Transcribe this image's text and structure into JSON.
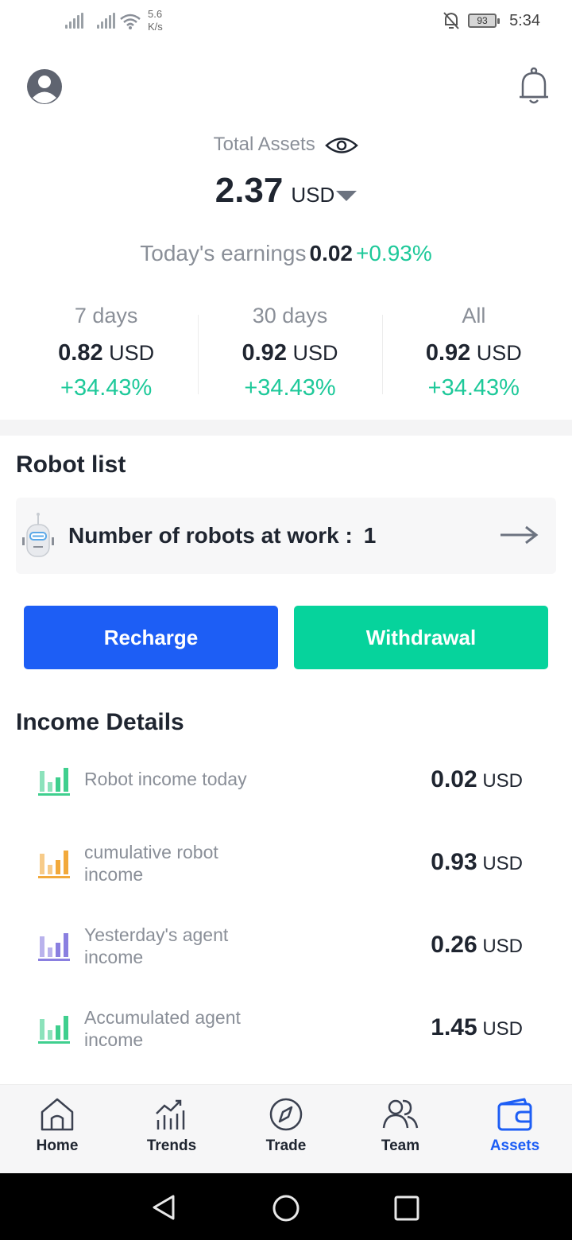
{
  "status_bar": {
    "speed": "5.6\nK/s",
    "speed_top": "5.6",
    "speed_bottom": "K/s",
    "battery": "93",
    "time": "5:34"
  },
  "header": {
    "total_assets_label": "Total Assets",
    "total_amount": "2.37",
    "currency": "USD"
  },
  "today": {
    "label": "Today's earnings",
    "value": "0.02",
    "percent": "+0.93%"
  },
  "periods": [
    {
      "label": "7 days",
      "amount": "0.82",
      "currency": "USD",
      "percent": "+34.43%"
    },
    {
      "label": "30 days",
      "amount": "0.92",
      "currency": "USD",
      "percent": "+34.43%"
    },
    {
      "label": "All",
      "amount": "0.92",
      "currency": "USD",
      "percent": "+34.43%"
    }
  ],
  "robot_list": {
    "title": "Robot list",
    "label": "Number of robots at work :",
    "count": "1"
  },
  "actions": {
    "recharge": "Recharge",
    "withdrawal": "Withdrawal"
  },
  "income": {
    "title": "Income Details",
    "items": [
      {
        "label": "Robot income today",
        "amount": "0.02",
        "currency": "USD",
        "icon_color": "#3fcf8e"
      },
      {
        "label": "cumulative robot income",
        "amount": "0.93",
        "currency": "USD",
        "icon_color": "#f2a93b"
      },
      {
        "label": "Yesterday's agent income",
        "amount": "0.26",
        "currency": "USD",
        "icon_color": "#8a7fe0"
      },
      {
        "label": "Accumulated agent income",
        "amount": "1.45",
        "currency": "USD",
        "icon_color": "#3fcf8e"
      }
    ]
  },
  "nav": {
    "items": [
      {
        "label": "Home",
        "icon": "home-icon"
      },
      {
        "label": "Trends",
        "icon": "trends-icon"
      },
      {
        "label": "Trade",
        "icon": "compass-icon"
      },
      {
        "label": "Team",
        "icon": "team-icon"
      },
      {
        "label": "Assets",
        "icon": "wallet-icon"
      }
    ],
    "active": "Assets",
    "accent": "#1d5ef5"
  },
  "colors": {
    "green": "#1ec99a",
    "blue": "#1d5ef5",
    "teal": "#06d39c"
  }
}
